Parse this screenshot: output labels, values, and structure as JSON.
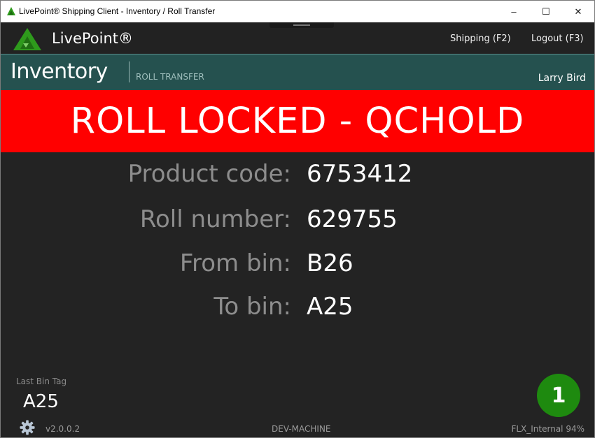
{
  "window": {
    "title": "LivePoint® Shipping Client - Inventory / Roll Transfer",
    "controls": {
      "minimize": "–",
      "maximize": "☐",
      "close": "✕"
    }
  },
  "header": {
    "brand": "LivePoint®",
    "nav": {
      "shipping": "Shipping (F2)",
      "logout": "Logout (F3)"
    }
  },
  "module": {
    "title": "Inventory",
    "subtitle": "ROLL TRANSFER",
    "user": "Larry Bird"
  },
  "banner": {
    "text": "ROLL LOCKED - QCHOLD",
    "color": "#ff0000"
  },
  "details": [
    {
      "label": "Product code:",
      "value": "6753412"
    },
    {
      "label": "Roll number:",
      "value": "629755"
    },
    {
      "label": "From bin:",
      "value": "B26"
    },
    {
      "label": "To bin:",
      "value": "A25"
    }
  ],
  "footer": {
    "last_bin_tag_label": "Last Bin Tag",
    "last_bin_tag_value": "A25",
    "version": "v2.0.0.2",
    "machine": "DEV-MACHINE",
    "status": "FLX_Internal  94%",
    "badge_count": "1",
    "settings_icon": "gear-icon"
  },
  "colors": {
    "accent": "#25514f",
    "badge": "#1e8a0f",
    "logo": "#2e9a1c"
  }
}
